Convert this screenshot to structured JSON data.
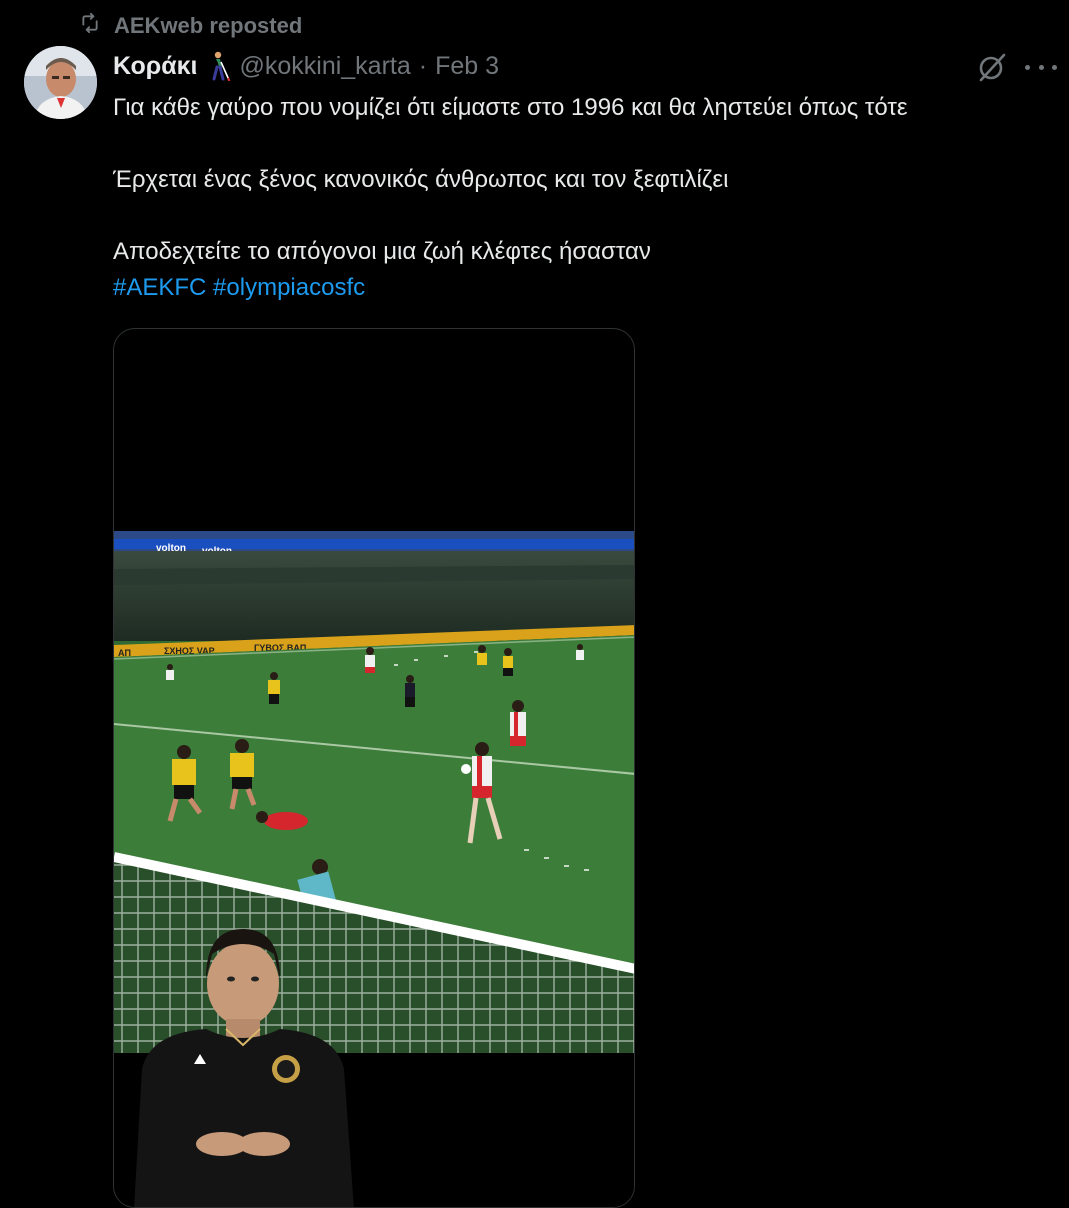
{
  "repost": {
    "icon": "repost-icon",
    "text": "AEKweb reposted"
  },
  "tweet": {
    "display_name": "Κοράκι",
    "name_emoji": "person-with-white-cane-emoji",
    "handle": "@kokkini_karta",
    "separator": "·",
    "date": "Feb 3",
    "lines": [
      "Για κάθε γαύρο που νομίζει ότι είμαστε στο 1996 και θα ληστεύει όπως τότε",
      "Έρχεται ένας ξένος κανονικός άνθρωπος και τον ξεφτιλίζει",
      "Αποδεχτείτε το απόγονοι μια ζωή κλέφτες ήσασταν"
    ],
    "hashtags": [
      "#AEKFC",
      "#olympiacosfc"
    ]
  },
  "actions": {
    "grok_icon": "grok-icon",
    "more_icon": "more-icon"
  },
  "media": {
    "type": "video",
    "description_icon": "football-video-thumbnail",
    "ad_boards": [
      "volton",
      "volton",
      "ΑΠ",
      "ΣΧΗΟΣ VAP",
      "ΓΥΒΟΣ ΒΑΠ"
    ]
  },
  "colors": {
    "background": "#000000",
    "text": "#e7e9ea",
    "muted": "#71767b",
    "hashtag": "#1d9bf0",
    "media_border": "#2f3336"
  }
}
